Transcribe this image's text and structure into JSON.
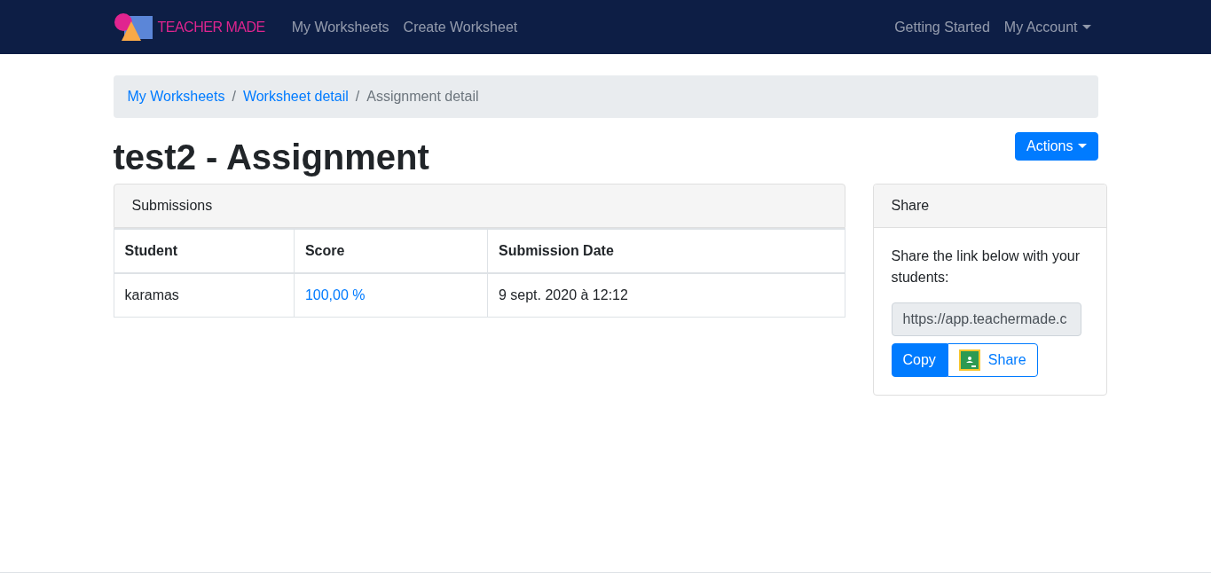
{
  "navbar": {
    "brand": "TEACHER MADE",
    "links": [
      {
        "label": "My Worksheets"
      },
      {
        "label": "Create Worksheet"
      }
    ],
    "right_links": [
      {
        "label": "Getting Started",
        "dropdown": false
      },
      {
        "label": "My Account",
        "dropdown": true
      }
    ]
  },
  "breadcrumb": [
    {
      "label": "My Worksheets",
      "current": false
    },
    {
      "label": "Worksheet detail",
      "current": false,
      "separator": "/"
    },
    {
      "label": "Assignment detail",
      "current": true,
      "separator": "/"
    }
  ],
  "title": "test2 - Assignment",
  "actions_button": "Actions",
  "submissions": {
    "header": "Submissions",
    "columns": [
      "Student",
      "Score",
      "Submission Date"
    ],
    "rows": [
      {
        "student": "karamas",
        "score": "100,00 %",
        "date": "9 sept. 2020 à 12:12"
      }
    ]
  },
  "share": {
    "header": "Share",
    "text": "Share the link below with your students:",
    "link_value": "https://app.teachermade.c",
    "copy_button": "Copy",
    "classroom_button": "Share"
  }
}
